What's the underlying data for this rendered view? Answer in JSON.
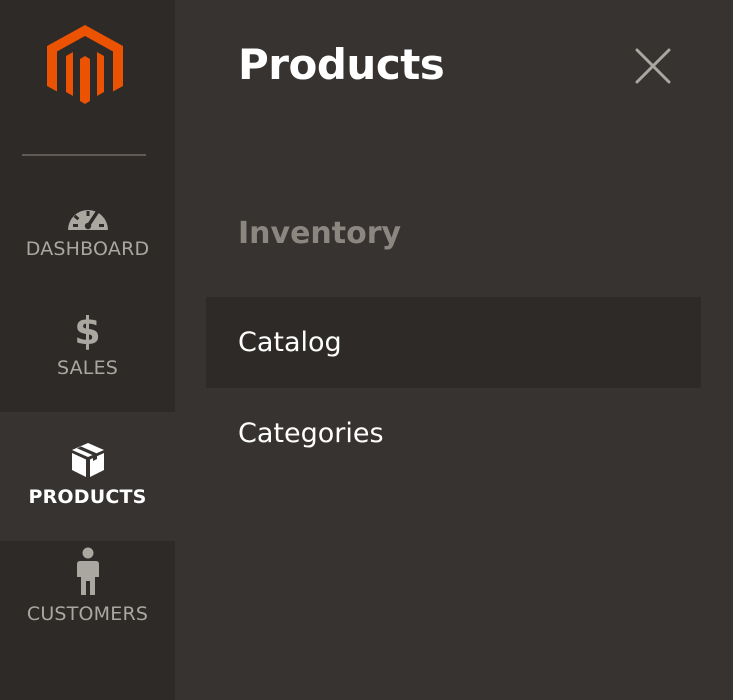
{
  "brand": {
    "logo_icon": "magento-logo-icon",
    "accent_color": "#eb5202"
  },
  "nav": {
    "items": [
      {
        "label": "DASHBOARD",
        "icon": "speedometer-icon",
        "active": false
      },
      {
        "label": "SALES",
        "icon": "dollar-icon",
        "glyph": "$",
        "active": false
      },
      {
        "label": "PRODUCTS",
        "icon": "box-icon",
        "active": true
      },
      {
        "label": "CUSTOMERS",
        "icon": "person-icon",
        "active": false
      }
    ]
  },
  "panel": {
    "title": "Products",
    "close_icon": "close-icon",
    "section_heading": "Inventory",
    "submenu": [
      {
        "label": "Catalog",
        "active": true
      },
      {
        "label": "Categories",
        "active": false
      }
    ]
  },
  "colors": {
    "nav_bg": "#2d2a27",
    "panel_bg": "#373330",
    "nav_text": "#aaa6a0",
    "heading_muted": "#8b8680"
  }
}
